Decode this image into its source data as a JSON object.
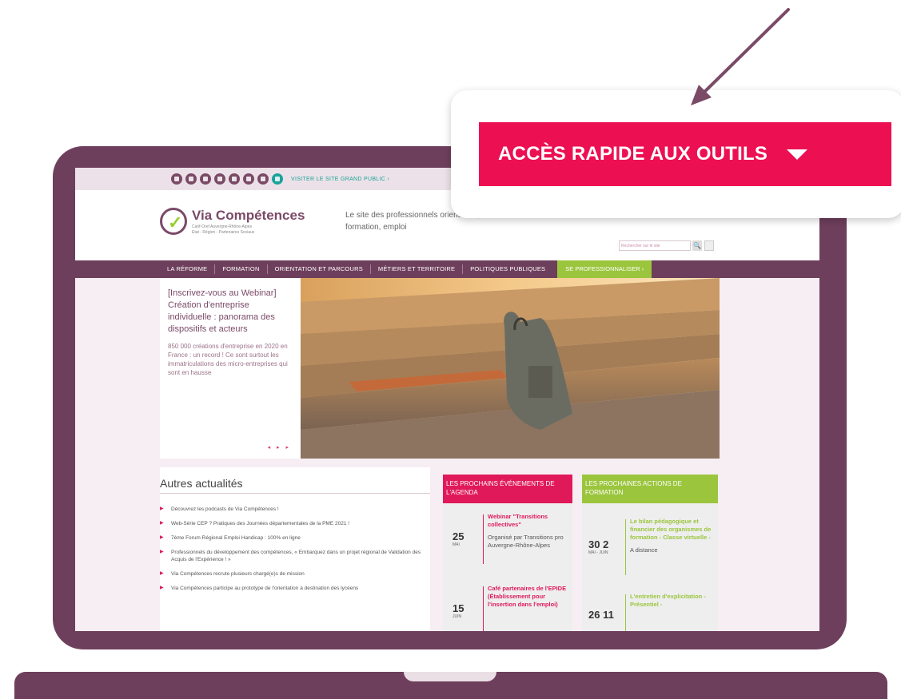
{
  "site": {
    "topbar": {
      "social_icons": [
        "facebook-icon",
        "linkedin-icon",
        "twitter-icon",
        "instagram-icon",
        "youtube-icon",
        "rss-icon",
        "mail-icon",
        "public-site-icon"
      ],
      "public_link": "VISITER LE SITE GRAND PUBLIC ›"
    },
    "header": {
      "logo_title": "Via Compétences",
      "logo_sub1": "Carif-Oref Auvergne-Rhône-Alpes",
      "logo_sub2": "Etat - Région - Partenaires Sociaux",
      "tagline": "Le site des professionnels orientation, formation, emploi",
      "search_placeholder": "Rechercher sur le site",
      "search_button": "🔍"
    },
    "nav": {
      "items": [
        "LA RÉFORME",
        "FORMATION",
        "ORIENTATION ET PARCOURS",
        "MÉTIERS ET TERRITOIRE",
        "POLITIQUES PUBLIQUES"
      ],
      "cta": "SE PROFESSIONNALISER ›"
    },
    "hero": {
      "title": "[Inscrivez-vous au Webinar] Création d'entreprise individuelle : panorama des dispositifs et acteurs",
      "text": "850 000 créations d'entreprise en 2020 en France : un record ! Ce sont surtout les immatriculations des micro-entreprises qui sont en hausse",
      "arrows": "◂ ▸ ▸"
    },
    "news": {
      "title": "Autres actualités",
      "items": [
        "Découvrez les podcasts de Via Compétences !",
        "Web-Série CEP ? Pratiques des Journées départementales de la PME 2021 !",
        "7ème Forum Régional Emploi Handicap : 100% en ligne",
        "Professionnels du développement des compétences, « Embarquez dans un projet régional de Validation des Acquis de l'Expérience ! »",
        "Via Compétences recrute plusieurs chargé(e)s de mission",
        "Via Compétences participe au prototype de l'orientation à destination des lycéens"
      ]
    },
    "agenda": {
      "title": "LES PROCHAINS ÉVÉNEMENTS DE L'AGENDA",
      "events": [
        {
          "day": "25",
          "month": "MAI",
          "title": "Webinar \"Transitions collectives\"",
          "desc": "Organisé par Transitions pro Auvergne-Rhône-Alpes"
        },
        {
          "day": "15",
          "month": "JUIN",
          "title": "Café partenaires de l'EPIDE (Établissement pour l'insertion dans l'emploi)",
          "desc": ""
        }
      ]
    },
    "training": {
      "title": "LES PROCHAINES ACTIONS DE FORMATION",
      "events": [
        {
          "day": "30  2",
          "month": "MAI - JUIN",
          "title": "Le bilan pédagogique et financier des organismes de formation - Classe virtuelle -",
          "desc": "A distance"
        },
        {
          "day": "26  11",
          "month": "",
          "title": "L'entretien d'explicitation - Présentiel -",
          "desc": ""
        }
      ]
    }
  },
  "callout": {
    "label": "ACCÈS RAPIDE AUX OUTILS",
    "icon": "caret-down-icon",
    "color": "#ec1053"
  },
  "colors": {
    "plum": "#6e3f5c",
    "pink": "#e0195a",
    "green": "#9bc53d",
    "teal": "#1aa39a"
  }
}
